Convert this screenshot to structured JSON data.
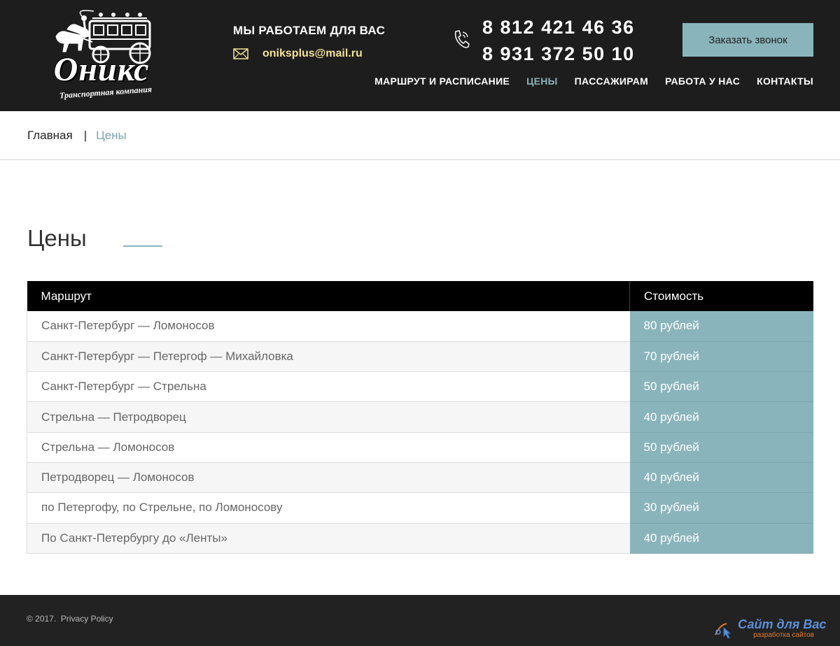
{
  "header": {
    "logo_word": "Оникс",
    "logo_sub": "Транспортная компания",
    "work_title": "МЫ РАБОТАЕМ ДЛЯ ВАС",
    "email": "oniksplus@mail.ru",
    "phone1": "8 812 421 46 36",
    "phone2": "8 931 372 50 10",
    "callback_label": "Заказать звонок",
    "nav": [
      {
        "label": "МАРШРУТ И РАСПИСАНИЕ",
        "active": false
      },
      {
        "label": "ЦЕНЫ",
        "active": true
      },
      {
        "label": "ПАССАЖИРАМ",
        "active": false
      },
      {
        "label": "РАБОТА У НАС",
        "active": false
      },
      {
        "label": "КОНТАКТЫ",
        "active": false
      }
    ]
  },
  "breadcrumb": {
    "home": "Главная",
    "separator": "|",
    "current": "Цены"
  },
  "page": {
    "title": "Цены"
  },
  "price_table": {
    "headers": {
      "route": "Маршрут",
      "price": "Стоимость"
    },
    "rows": [
      {
        "route": "Санкт-Петербург — Ломоносов",
        "price": "80 рублей"
      },
      {
        "route": "Санкт-Петербург — Петергоф — Михайловка",
        "price": "70 рублей"
      },
      {
        "route": "Санкт-Петербург — Стрельна",
        "price": "50 рублей"
      },
      {
        "route": "Стрельна — Петродворец",
        "price": "40 рублей"
      },
      {
        "route": "Стрельна — Ломоносов",
        "price": "50 рублей"
      },
      {
        "route": "Петродворец — Ломоносов",
        "price": "40 рублей"
      },
      {
        "route": "по Петергофу, по Стрельне, по Ломоносову",
        "price": "30 рублей"
      },
      {
        "route": "По Санкт-Петербургу до «Ленты»",
        "price": "40 рублей"
      }
    ]
  },
  "footer": {
    "copyright": "© 2017.",
    "privacy": "Privacy Policy",
    "dev_name": "Сайт для Вас",
    "dev_sub": "разработка сайтов"
  },
  "colors": {
    "header_bg": "#1d1d1d",
    "accent": "#8ab4bb",
    "email": "#f3e399",
    "footer_bg": "#222222"
  },
  "icons": {
    "mail": "mail-icon",
    "phone": "phone-icon",
    "logo_carriage": "carriage-icon",
    "dev_logo": "cursor-hand-icon"
  }
}
